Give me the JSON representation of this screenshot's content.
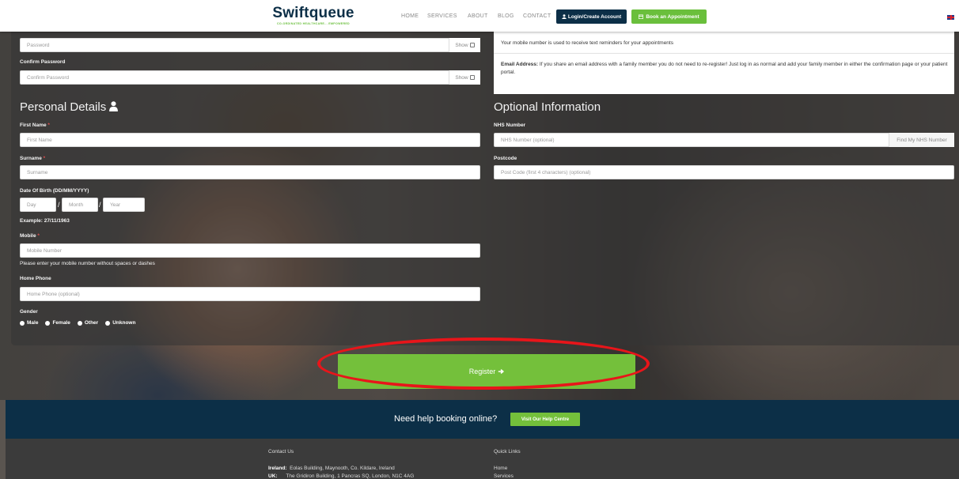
{
  "header": {
    "logo_text": "Swiftqueue",
    "logo_tagline": "CO-ORDINATED HEALTHCARE... EMPOWERED",
    "nav": [
      "HOME",
      "SERVICES",
      "ABOUT",
      "BLOG",
      "CONTACT"
    ],
    "login_label": "Login/Create Account",
    "book_label": "Book an Appointment"
  },
  "account": {
    "password_placeholder": "Password",
    "password_show": "Show",
    "confirm_label": "Confirm Password",
    "confirm_placeholder": "Confirm Password",
    "confirm_show": "Show"
  },
  "info": {
    "mobile_note": "Your mobile number is used to receive text reminders for your appointments",
    "email_bold": "Email Address:",
    "email_note": "If you share an email address with a family member you do not need to re-register! Just log in as normal and add your family member in either the confirmation page or your patient portal."
  },
  "personal": {
    "title": "Personal Details",
    "first_name_label": "First Name",
    "first_name_placeholder": "First Name",
    "surname_label": "Surname",
    "surname_placeholder": "Surname",
    "dob_label": "Date Of Birth (DD/MM/YYYY)",
    "dob_day": "Day",
    "dob_month": "Month",
    "dob_year": "Year",
    "dob_sep": "/",
    "dob_example": "Example: 27/11/1963",
    "mobile_label": "Mobile",
    "mobile_placeholder": "Mobile Number",
    "mobile_hint": "Please enter your mobile number without spaces or dashes",
    "home_phone_label": "Home Phone",
    "home_phone_placeholder": "Home Phone (optional)",
    "gender_label": "Gender",
    "gender_options": [
      "Male",
      "Female",
      "Other",
      "Unknown"
    ]
  },
  "optional": {
    "title": "Optional Information",
    "nhs_label": "NHS Number",
    "nhs_placeholder": "NHS Number (optional)",
    "nhs_button": "Find My NHS Number",
    "postcode_label": "Postcode",
    "postcode_placeholder": "Post Code (first 4 characters) (optional)"
  },
  "register_label": "Register",
  "help": {
    "text": "Need help booking online?",
    "button": "Visit Our Help Centre"
  },
  "footer": {
    "contact_title": "Contact Us",
    "ireland_label": "Ireland:",
    "ireland_address": "Eolas Building, Maynooth, Co. Kildare, Ireland",
    "uk_label": "UK:",
    "uk_address": "The Gridiron Building, 1 Pancras SQ, London, N1C 4AG",
    "quick_title": "Quick Links",
    "links": [
      "Home",
      "Services"
    ]
  },
  "colors": {
    "navy": "#0c2f47",
    "green": "#74c03b",
    "highlight_red": "#e8151a"
  }
}
